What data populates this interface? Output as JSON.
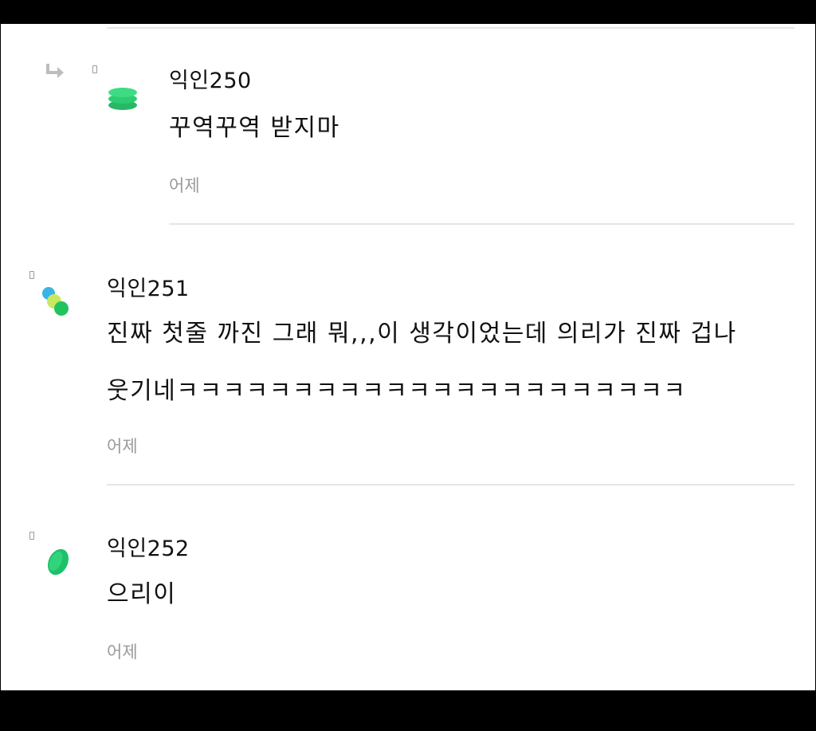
{
  "comments": [
    {
      "is_reply": true,
      "nickname": "익인250",
      "text_lines": [
        "꾸역꾸역 받지마"
      ],
      "time": "어제",
      "avatar_colors": [
        "#2ecc71",
        "#27b866"
      ]
    },
    {
      "is_reply": false,
      "nickname": "익인251",
      "text_lines": [
        "진짜 첫줄 까진 그래 뭐,,,이 생각이었는데 의리가 진짜 겁나",
        "웃기네ㅋㅋㅋㅋㅋㅋㅋㅋㅋㅋㅋㅋㅋㅋㅋㅋㅋㅋㅋㅋㅋㅋ"
      ],
      "time": "어제",
      "avatar_colors": [
        "#3ab4e6",
        "#c8e860",
        "#22c35e"
      ]
    },
    {
      "is_reply": false,
      "nickname": "익인252",
      "text_lines": [
        "으리이"
      ],
      "time": "어제",
      "avatar_colors": [
        "#1fc06a"
      ]
    }
  ],
  "icons": {
    "reply": "reply-arrow-icon",
    "flag": "flag-icon"
  },
  "colors": {
    "text": "#111111",
    "muted": "#9a9a9a",
    "divider": "#e6e6e6",
    "accent_green": "#2ecc71"
  }
}
